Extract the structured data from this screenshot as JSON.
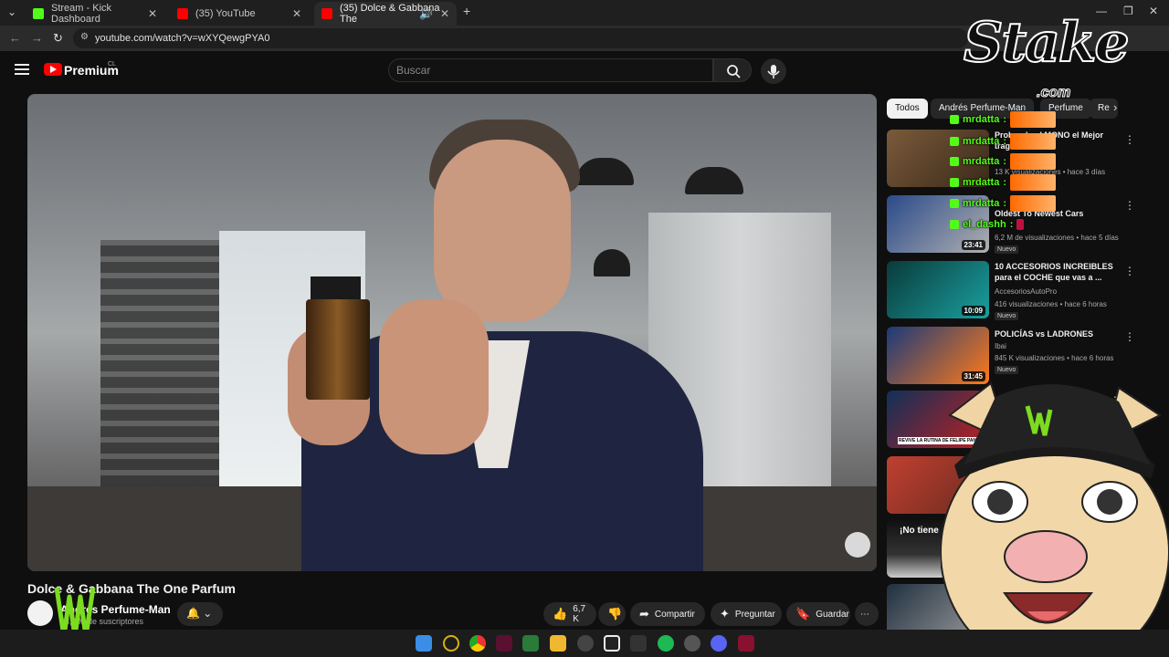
{
  "browser": {
    "tabs": [
      {
        "title": "Stream - Kick Dashboard",
        "active": false
      },
      {
        "title": "(35) YouTube",
        "active": false
      },
      {
        "title": "(35) Dolce & Gabbana The",
        "active": true
      }
    ],
    "new_tab": "+",
    "url": "youtube.com/watch?v=wXYQewgPYA0"
  },
  "youtube": {
    "brand": "Premium",
    "country": "CL",
    "search_placeholder": "Buscar",
    "video": {
      "title": "Dolce & Gabbana The One Parfum",
      "channel": "Andrés Perfume-Man",
      "subscribers": "63,9 M de suscriptores",
      "likes": "6,7 K",
      "actions": {
        "share": "Compartir",
        "ask": "Preguntar",
        "save": "Guardar"
      }
    },
    "chips": [
      "Todos",
      "Andrés Perfume-Man",
      "Perfume",
      "Re"
    ],
    "recommendations": [
      {
        "title": "Probando el MONO el Mejor trago de 2025",
        "channel": "",
        "meta": "13 K visualizaciones • hace 3 días",
        "duration": "",
        "badge": ""
      },
      {
        "title": "Oldest To Newest Cars",
        "channel": "",
        "meta": "6,2 M de visualizaciones • hace 5 días",
        "duration": "23:41",
        "badge": "Nuevo"
      },
      {
        "title": "10 ACCESORIOS INCREIBLES para el COCHE que vas a ...",
        "channel": "AccesoriosAutoPro",
        "meta": "416 visualizaciones • hace 6 horas",
        "duration": "10:09",
        "badge": "Nuevo"
      },
      {
        "title": "POLICÍAS vs LADRONES",
        "channel": "Ibai",
        "meta": "845 K visualizaciones • hace 6 horas",
        "duration": "31:45",
        "badge": "Nuevo"
      },
      {
        "title": "",
        "channel": "",
        "meta": "",
        "duration": "",
        "badge": ""
      },
      {
        "title": "",
        "channel": "",
        "meta": "",
        "duration": "",
        "badge": ""
      },
      {
        "title": "¡No tiene",
        "channel": "",
        "meta": "",
        "duration": "",
        "badge": ""
      },
      {
        "title": "",
        "channel": "",
        "meta": "",
        "duration": "",
        "badge": ""
      }
    ]
  },
  "overlay": {
    "sponsor": "Stake",
    "sponsor_domain": ".com",
    "chat": [
      {
        "user": "mrdatta",
        "text": ":"
      },
      {
        "user": "mrdatta",
        "text": ":"
      },
      {
        "user": "mrdatta",
        "text": ":"
      },
      {
        "user": "mrdatta",
        "text": ":"
      },
      {
        "user": "mrdatta",
        "text": ":"
      },
      {
        "user": "el_dashh",
        "text": ":"
      }
    ],
    "thumb_caption": "REVIVE LA RUTINA DE FELIPE PAN",
    "thumb_caption2": "¡No tiene!"
  },
  "colors": {
    "kick_green": "#53fc18",
    "yt_red": "#ff0000",
    "bg": "#0f0f0f"
  }
}
